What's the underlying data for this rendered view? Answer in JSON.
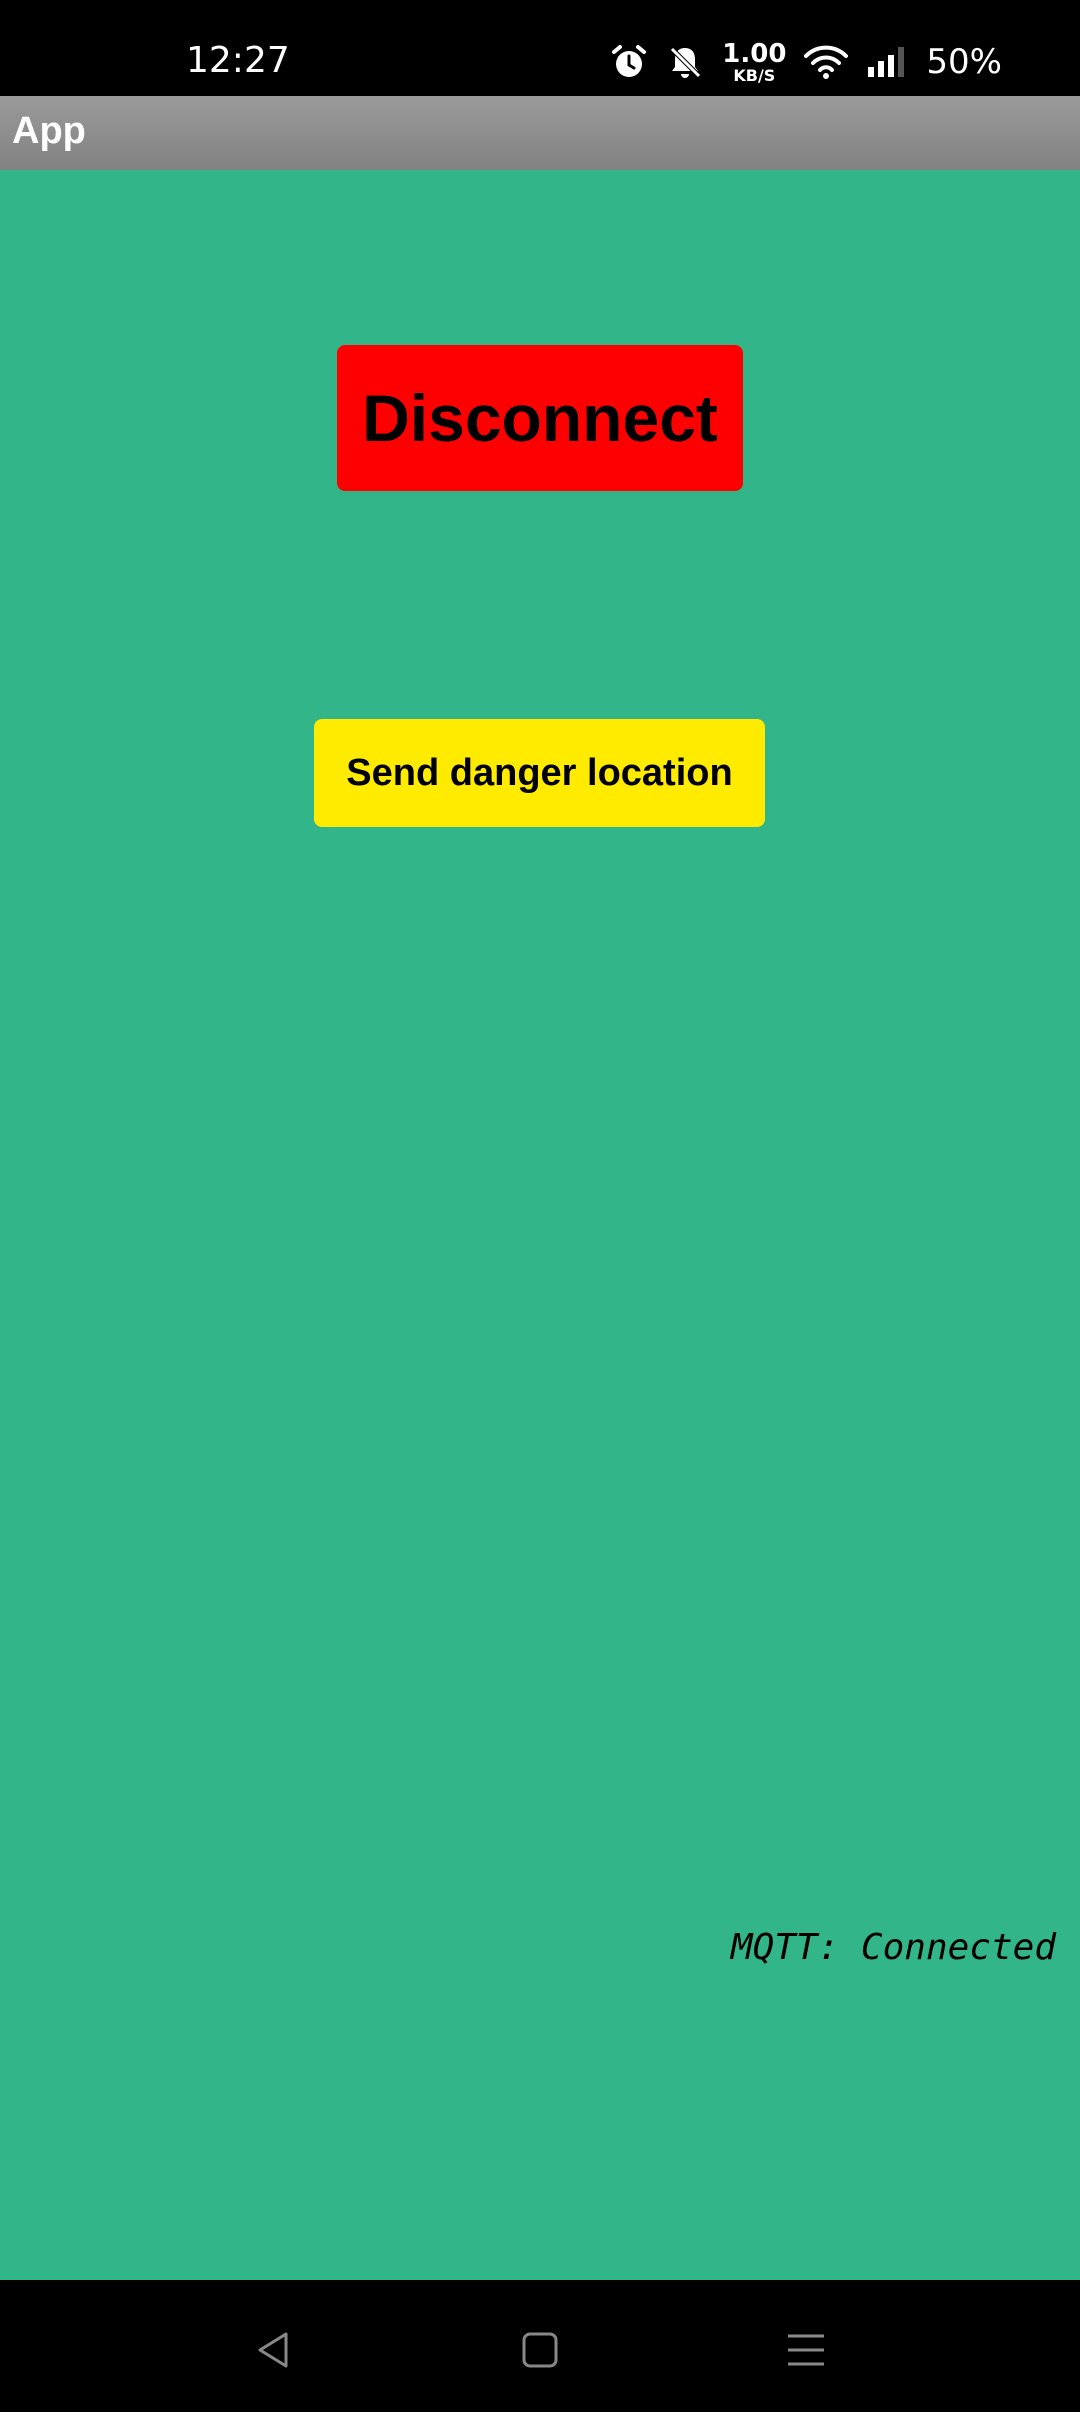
{
  "status_bar": {
    "time": "12:27",
    "net_speed_value": "1.00",
    "net_speed_unit": "KB/S",
    "battery_percent": "50%",
    "icons": [
      "alarm-icon",
      "bell-muted-icon",
      "wifi-icon",
      "signal-icon"
    ]
  },
  "app_bar": {
    "title": "App"
  },
  "main": {
    "disconnect_label": "Disconnect",
    "send_danger_label": "Send danger location",
    "mqtt_status": "MQTT: Connected"
  },
  "nav_bar": {
    "icons": [
      "back-icon",
      "home-icon",
      "recents-icon"
    ]
  },
  "colors": {
    "background": "#33b58a",
    "disconnect_button": "#ff0000",
    "danger_button": "#ffeb00",
    "app_bar": "#8f8f8f"
  }
}
